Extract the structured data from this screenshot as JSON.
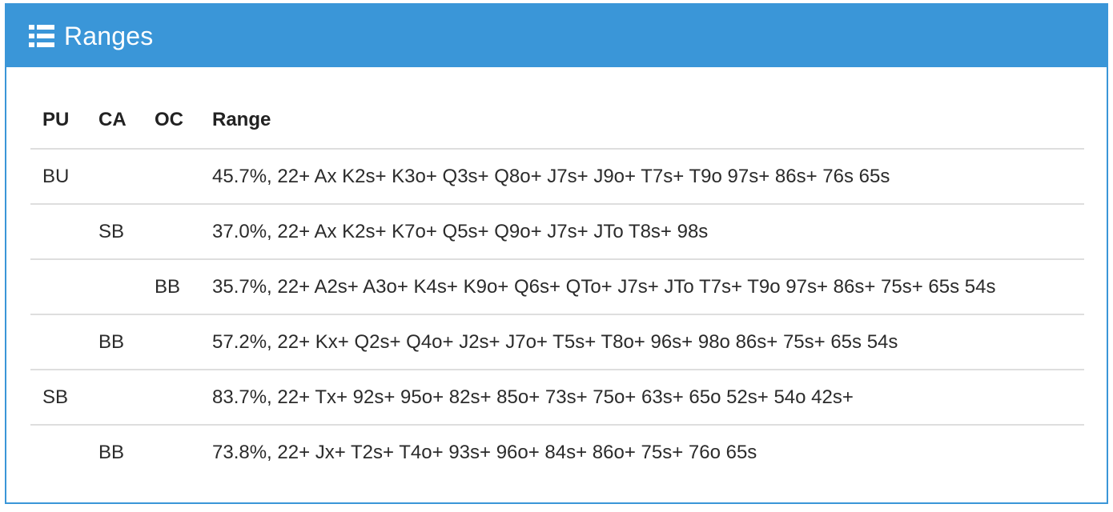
{
  "panel": {
    "title": "Ranges",
    "icon": "list-icon"
  },
  "table": {
    "headers": {
      "pu": "PU",
      "ca": "CA",
      "oc": "OC",
      "range": "Range"
    },
    "rows": [
      {
        "pu": "BU",
        "ca": "",
        "oc": "",
        "range": "45.7%, 22+ Ax K2s+ K3o+ Q3s+ Q8o+ J7s+ J9o+ T7s+ T9o 97s+ 86s+ 76s 65s"
      },
      {
        "pu": "",
        "ca": "SB",
        "oc": "",
        "range": "37.0%, 22+ Ax K2s+ K7o+ Q5s+ Q9o+ J7s+ JTo T8s+ 98s"
      },
      {
        "pu": "",
        "ca": "",
        "oc": "BB",
        "range": "35.7%, 22+ A2s+ A3o+ K4s+ K9o+ Q6s+ QTo+ J7s+ JTo T7s+ T9o 97s+ 86s+ 75s+ 65s 54s"
      },
      {
        "pu": "",
        "ca": "BB",
        "oc": "",
        "range": "57.2%, 22+ Kx+ Q2s+ Q4o+ J2s+ J7o+ T5s+ T8o+ 96s+ 98o 86s+ 75s+ 65s 54s"
      },
      {
        "pu": "SB",
        "ca": "",
        "oc": "",
        "range": "83.7%, 22+ Tx+ 92s+ 95o+ 82s+ 85o+ 73s+ 75o+ 63s+ 65o 52s+ 54o 42s+"
      },
      {
        "pu": "",
        "ca": "BB",
        "oc": "",
        "range": "73.8%, 22+ Jx+ T2s+ T4o+ 93s+ 96o+ 84s+ 86o+ 75s+ 76o 65s"
      }
    ]
  },
  "colors": {
    "accent": "#3a96d8",
    "text": "#2b2b2b",
    "divider": "#dedede"
  }
}
